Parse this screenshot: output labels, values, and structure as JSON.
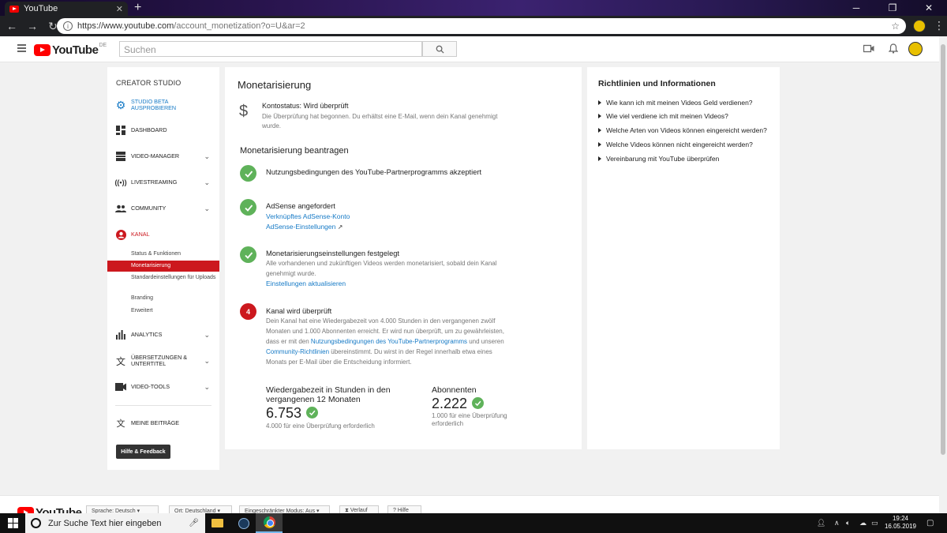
{
  "browser": {
    "tab_title": "YouTube",
    "url_host": "https://www.youtube.com",
    "url_path": "/account_monetization?o=U&ar=2"
  },
  "header": {
    "logo_text": "YouTube",
    "region": "DE",
    "search_placeholder": "Suchen"
  },
  "sidebar": {
    "title": "CREATOR STUDIO",
    "studio_beta": "STUDIO BETA AUSPROBIEREN",
    "items": [
      {
        "label": "DASHBOARD"
      },
      {
        "label": "VIDEO-MANAGER"
      },
      {
        "label": "LIVESTREAMING"
      },
      {
        "label": "COMMUNITY"
      },
      {
        "label": "KANAL"
      },
      {
        "label": "ANALYTICS"
      },
      {
        "label": "ÜBERSETZUNGEN & UNTERTITEL"
      },
      {
        "label": "VIDEO-TOOLS"
      }
    ],
    "kanal_sub": [
      "Status & Funktionen",
      "Monetarisierung",
      "Standardeinstellungen für Uploads",
      "Branding",
      "Erweitert"
    ],
    "meine_beitraege": "MEINE BEITRÄGE",
    "help_button": "Hilfe & Feedback"
  },
  "main": {
    "title": "Monetarisierung",
    "account_status": "Kontostatus: Wird überprüft",
    "account_desc": "Die Überprüfung hat begonnen. Du erhältst eine E-Mail, wenn dein Kanal genehmigt wurde.",
    "section_title": "Monetarisierung beantragen",
    "step1_title": "Nutzungsbedingungen des YouTube-Partnerprogramms akzeptiert",
    "step2_title": "AdSense angefordert",
    "step2_link1": "Verknüpftes AdSense-Konto",
    "step2_link2": "AdSense-Einstellungen",
    "step3_title": "Monetarisierungseinstellungen festgelegt",
    "step3_desc": "Alle vorhandenen und zukünftigen Videos werden monetarisiert, sobald dein Kanal genehmigt wurde.",
    "step3_link": "Einstellungen aktualisieren",
    "step4_number": "4",
    "step4_title": "Kanal wird überprüft",
    "step4_desc_a": "Dein Kanal hat eine Wiedergabezeit von 4.000 Stunden in den vergangenen zwölf Monaten und 1.000 Abonnenten erreicht. Er wird nun überprüft, um zu gewährleisten, dass er mit den ",
    "step4_link_a": "Nutzungsbedingungen des YouTube-Partnerprogramms",
    "step4_desc_b": " und unseren ",
    "step4_link_b": "Community-Richtlinien",
    "step4_desc_c": " übereinstimmt. Du wirst in der Regel innerhalb etwa eines Monats per E-Mail über die Entscheidung informiert.",
    "watchtime_label": "Wiedergabezeit in Stunden in den vergangenen 12 Monaten",
    "watchtime_value": "6.753",
    "watchtime_note": "4.000 für eine Überprüfung erforderlich",
    "subs_label": "Abonnenten",
    "subs_value": "2.222",
    "subs_note": "1.000 für eine Überprüfung erforderlich"
  },
  "right": {
    "title": "Richtlinien und Informationen",
    "items": [
      "Wie kann ich mit meinen Videos Geld verdienen?",
      "Wie viel verdiene ich mit meinen Videos?",
      "Welche Arten von Videos können eingereicht werden?",
      "Welche Videos können nicht eingereicht werden?",
      "Vereinbarung mit YouTube überprüfen"
    ]
  },
  "footer": {
    "language": "Sprache: Deutsch",
    "location": "Ort: Deutschland",
    "restricted": "Eingeschränkter Modus: Aus",
    "history": "Verlauf",
    "help": "Hilfe"
  },
  "taskbar": {
    "search_placeholder": "Zur Suche Text hier eingeben",
    "time": "19:24",
    "date": "16.05.2019"
  }
}
